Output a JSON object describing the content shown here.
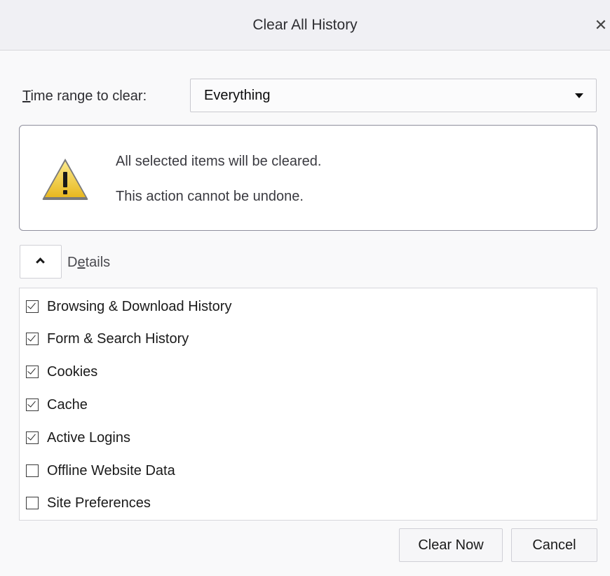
{
  "dialog": {
    "title": "Clear All History",
    "close_glyph": "✕"
  },
  "time_range": {
    "label_access_key": "T",
    "label_rest": "ime range to clear:",
    "selected": "Everything"
  },
  "warning": {
    "icon": "warning-triangle-icon",
    "line1": "All selected items will be cleared.",
    "line2": "This action cannot be undone."
  },
  "details": {
    "label_before": "D",
    "label_access_key": "e",
    "label_after": "tails",
    "expanded": true
  },
  "items": [
    {
      "label": "Browsing & Download History",
      "checked": true
    },
    {
      "label": "Form & Search History",
      "checked": true
    },
    {
      "label": "Cookies",
      "checked": true
    },
    {
      "label": "Cache",
      "checked": true
    },
    {
      "label": "Active Logins",
      "checked": true
    },
    {
      "label": "Offline Website Data",
      "checked": false
    },
    {
      "label": "Site Preferences",
      "checked": false
    }
  ],
  "buttons": {
    "clear_now": "Clear Now",
    "cancel": "Cancel"
  },
  "colors": {
    "warning_yellow": "#f3d23a",
    "warning_border": "#8f8f9d"
  }
}
